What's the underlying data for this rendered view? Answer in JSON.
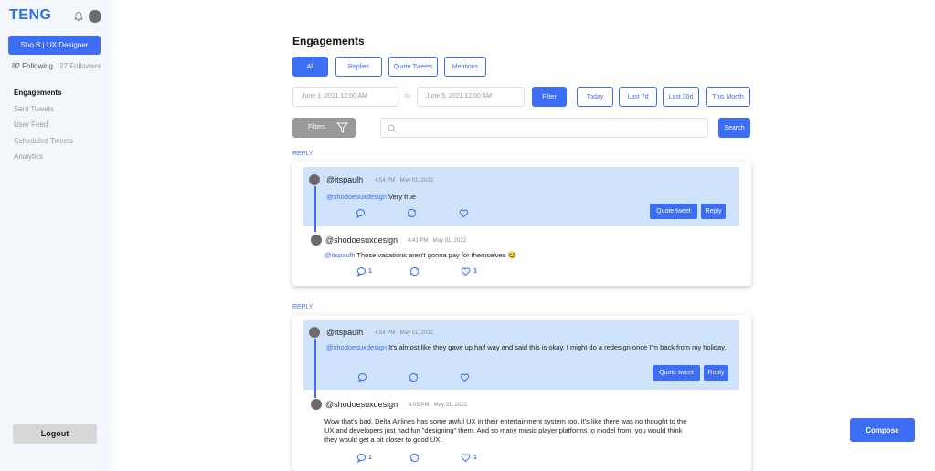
{
  "app": {
    "brand": "TENG"
  },
  "sidebar": {
    "profile_button": "Sho B | UX Designer",
    "following": "82 Following",
    "followers": "27 Followers",
    "nav": [
      {
        "label": "Engagements",
        "active": true
      },
      {
        "label": "Sent Tweets"
      },
      {
        "label": "User Feed"
      },
      {
        "label": "Scheduled Tweets"
      },
      {
        "label": "Analytics"
      }
    ],
    "logout": "Logout"
  },
  "main": {
    "title": "Engagements",
    "tabs": [
      "All",
      "Replies",
      "Quote Tweets",
      "Mentions"
    ],
    "active_tab": "All",
    "date_from": "June 1, 2021 12:00 AM",
    "to_label": "to",
    "date_to": "June 5, 2021 12:00 AM",
    "filter_button": "Filter",
    "quick_ranges": [
      "Today",
      "Last 7d",
      "Last 30d",
      "This Month"
    ],
    "filters_button": "Filters",
    "search_button": "Search"
  },
  "engagements": [
    {
      "type_label": "REPLY",
      "original": {
        "handle": "@itspaulh",
        "meta": "4:54 PM · May 01, 2022",
        "mention": "@shodoesuxdesign",
        "text": " Very true",
        "quote_button": "Quote tweet",
        "reply_button": "Reply"
      },
      "reply": {
        "handle": "@shodoesuxdesign",
        "meta": "4:41 PM · May 01, 2022",
        "mention": "@itspaulh",
        "text": " Those vacations aren't gonna pay for themselves 😂",
        "comments": "1",
        "likes": "1"
      }
    },
    {
      "type_label": "REPLY",
      "original": {
        "handle": "@itspaulh",
        "meta": "4:54 PM · May 01, 2022",
        "mention": "@shodoesuxdesign",
        "text": " It's almost like they gave up half way and said this is okay. I might do a redesign once I'm back from my holiday.",
        "quote_button": "Quote tweet",
        "reply_button": "Reply"
      },
      "reply": {
        "handle": "@shodoesuxdesign",
        "meta": "9:05 PM · May 31, 2022",
        "text": "Wow that's bad. Delta Airlines has some awful UX in their entertainment system too. It's like there was no thought to the UX and developers just had fun \"designing\" them. And so many music player platforms to model from, you would think they would get a bit closer to good UX!",
        "comments": "1",
        "likes": "1"
      }
    }
  ],
  "compose_button": "Compose",
  "colors": {
    "accent": "#3d6df2",
    "quoted_bg": "#cfe3fb",
    "sidebar_bg": "#f3f6fb"
  },
  "icons": [
    "bell-icon",
    "filter-icon",
    "search-icon",
    "comment-icon",
    "retweet-icon",
    "heart-icon"
  ]
}
